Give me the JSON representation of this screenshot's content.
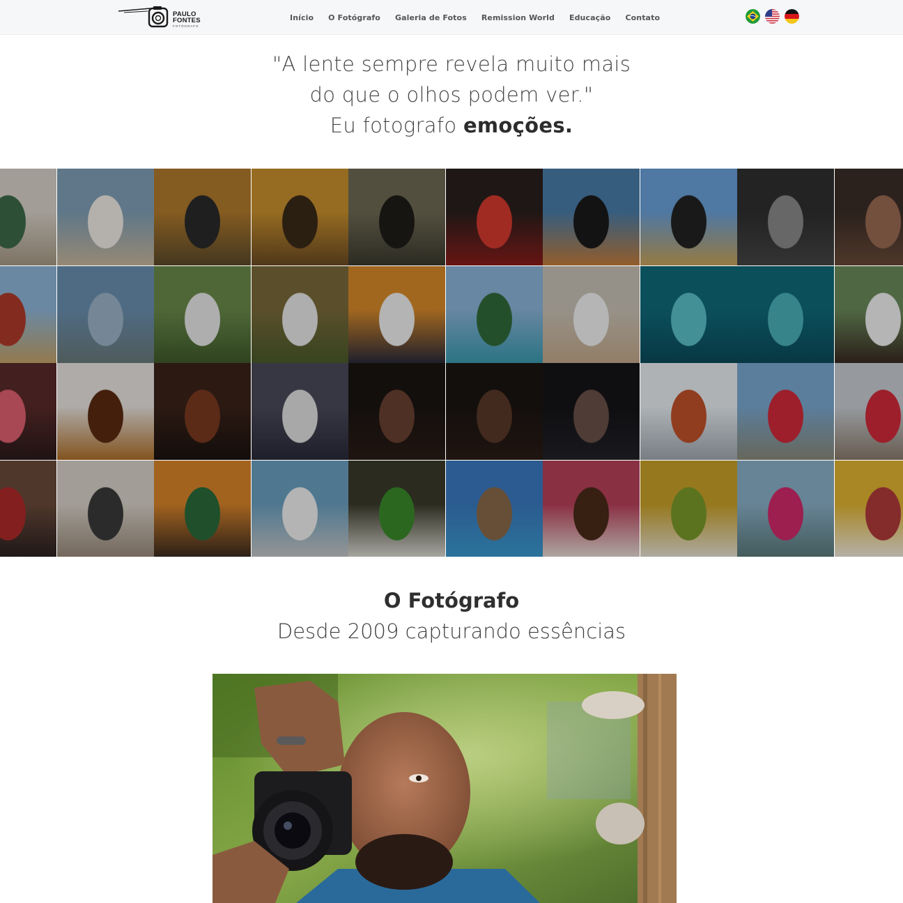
{
  "header": {
    "logo": {
      "line1": "PAULO",
      "line2": "FONTES",
      "tagline": "FOTÓGRAFO"
    },
    "nav": [
      {
        "label": "Início"
      },
      {
        "label": "O Fotógrafo"
      },
      {
        "label": "Galeria de Fotos"
      },
      {
        "label": "Remission World"
      },
      {
        "label": "Educação"
      },
      {
        "label": "Contato"
      }
    ],
    "languages": [
      {
        "name": "Português",
        "icon": "brazil-flag-icon"
      },
      {
        "name": "English",
        "icon": "usa-flag-icon"
      },
      {
        "name": "Deutsch",
        "icon": "germany-flag-icon"
      }
    ]
  },
  "hero": {
    "line1": "\"A lente sempre revela muito mais",
    "line2": "do que o olhos podem ver.\"",
    "line3_prefix": "Eu fotografo ",
    "line3_bold": "emoções."
  },
  "gallery": {
    "rows": 4,
    "columns": 10,
    "tiles": [
      {
        "top": "#d8d2c8",
        "bottom": "#a89a86",
        "accent": "#3d6a48"
      },
      {
        "top": "#7f9fb6",
        "bottom": "#c9b79c",
        "accent": "#f0ece6"
      },
      {
        "top": "#b07a2c",
        "bottom": "#5b4a2a",
        "accent": "#2a2a2a"
      },
      {
        "top": "#c9902e",
        "bottom": "#6a4a22",
        "accent": "#3a2a18"
      },
      {
        "top": "#6f6a55",
        "bottom": "#3b3a2e",
        "accent": "#1e1c18"
      },
      {
        "top": "#2a1f1c",
        "bottom": "#8a1d1a",
        "accent": "#d63a2f"
      },
      {
        "top": "#4a7ca8",
        "bottom": "#c47d3a",
        "accent": "#1a1a1a"
      },
      {
        "top": "#6aa0d8",
        "bottom": "#c9a35a",
        "accent": "#222222"
      },
      {
        "top": "#2f2f2f",
        "bottom": "#454545",
        "accent": "#8a8a8a"
      },
      {
        "top": "#3a2e28",
        "bottom": "#6a4a38",
        "accent": "#9a6a52"
      },
      {
        "top": "#8fb6d8",
        "bottom": "#c5a46a",
        "accent": "#b03a2a"
      },
      {
        "top": "#6a8fb0",
        "bottom": "#6a7a7a",
        "accent": "#9cb4c8"
      },
      {
        "top": "#6a8a4a",
        "bottom": "#3f5a2a",
        "accent": "#e8e8e8"
      },
      {
        "top": "#7a6a3a",
        "bottom": "#4a5a2a",
        "accent": "#e8e8e8"
      },
      {
        "top": "#d88a2a",
        "bottom": "#2a2a3a",
        "accent": "#f0f0f0"
      },
      {
        "top": "#8ab4d8",
        "bottom": "#3a9ab0",
        "accent": "#2f6a3a"
      },
      {
        "top": "#c9c2b6",
        "bottom": "#c4a98a",
        "accent": "#f2f2f2"
      },
      {
        "top": "#0f6a7a",
        "bottom": "#0a4a5a",
        "accent": "#5ac0c8"
      },
      {
        "top": "#0f6a7a",
        "bottom": "#0a4a5a",
        "accent": "#4ab0b8"
      },
      {
        "top": "#6a8a5a",
        "bottom": "#3a2a22",
        "accent": "#f2f2f2"
      },
      {
        "top": "#5a2a2a",
        "bottom": "#2a1a1a",
        "accent": "#e06070"
      },
      {
        "top": "#e8e4e0",
        "bottom": "#b0702a",
        "accent": "#5a2a10"
      },
      {
        "top": "#3a2218",
        "bottom": "#1a1210",
        "accent": "#7a3a20"
      },
      {
        "top": "#4a4a5a",
        "bottom": "#2a2a3a",
        "accent": "#e0e0e0"
      },
      {
        "top": "#1a1412",
        "bottom": "#2a1c16",
        "accent": "#6a4030"
      },
      {
        "top": "#1a1412",
        "bottom": "#2a1c16",
        "accent": "#5a3828"
      },
      {
        "top": "#141418",
        "bottom": "#222228",
        "accent": "#6a5048"
      },
      {
        "top": "#e8eef2",
        "bottom": "#a0a8b0",
        "accent": "#c0502a"
      },
      {
        "top": "#7aa8d0",
        "bottom": "#8a8a7a",
        "accent": "#d02a3a"
      },
      {
        "top": "#c8ced4",
        "bottom": "#8a7a6a",
        "accent": "#d02a3a"
      },
      {
        "top": "#6a4a3a",
        "bottom": "#2a2020",
        "accent": "#b02a2a"
      },
      {
        "top": "#d8d2c8",
        "bottom": "#9a8a7a",
        "accent": "#3a3a3a"
      },
      {
        "top": "#d8842a",
        "bottom": "#3a2a20",
        "accent": "#2a6a3a"
      },
      {
        "top": "#6aa0c0",
        "bottom": "#c8c8c8",
        "accent": "#f0f0f0"
      },
      {
        "top": "#3a3a2a",
        "bottom": "#e0e0d8",
        "accent": "#3a8a2a"
      },
      {
        "top": "#3a7ac0",
        "bottom": "#3a9ad0",
        "accent": "#8a6a4a"
      },
      {
        "top": "#b8405a",
        "bottom": "#e8e0d8",
        "accent": "#4a2a18"
      },
      {
        "top": "#c8a028",
        "bottom": "#e8e4d8",
        "accent": "#7a9a2a"
      },
      {
        "top": "#8ab0c8",
        "bottom": "#5a7a7a",
        "accent": "#d02a6a"
      },
      {
        "top": "#e0b430",
        "bottom": "#f2ece2",
        "accent": "#b03a3a"
      }
    ]
  },
  "about": {
    "title": "O Fotógrafo",
    "subtitle": "Desde 2009 capturando essências"
  },
  "colors": {
    "header_bg": "#f6f7f9",
    "text_dark": "#2f2f2f",
    "nav_text": "#555555"
  }
}
